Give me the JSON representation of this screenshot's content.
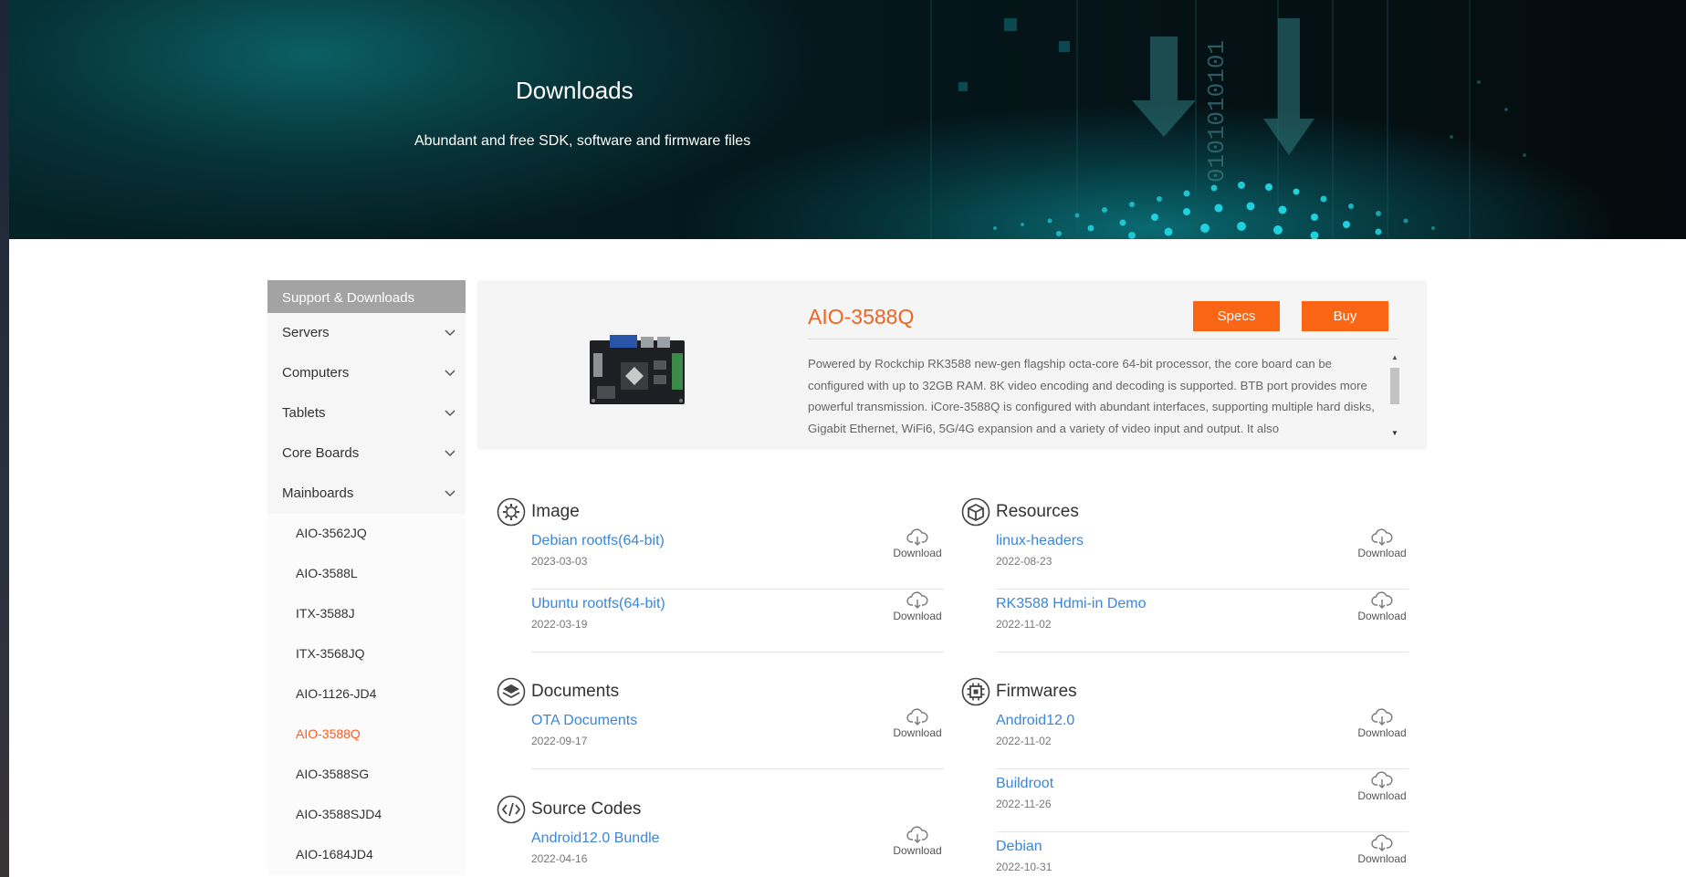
{
  "banner": {
    "title": "Downloads",
    "subtitle": "Abundant and free SDK, software and firmware files"
  },
  "sidebar": {
    "header": "Support & Downloads",
    "categories": [
      {
        "label": "Servers"
      },
      {
        "label": "Computers"
      },
      {
        "label": "Tablets"
      },
      {
        "label": "Core Boards"
      },
      {
        "label": "Mainboards"
      }
    ],
    "mainboards": [
      {
        "label": "AIO-3562JQ"
      },
      {
        "label": "AIO-3588L"
      },
      {
        "label": "ITX-3588J"
      },
      {
        "label": "ITX-3568JQ"
      },
      {
        "label": "AIO-1126-JD4"
      },
      {
        "label": "AIO-3588Q"
      },
      {
        "label": "AIO-3588SG"
      },
      {
        "label": "AIO-3588SJD4"
      },
      {
        "label": "AIO-1684JD4"
      }
    ],
    "active_item": "AIO-3588Q"
  },
  "product": {
    "title": "AIO-3588Q",
    "specs_label": "Specs",
    "buy_label": "Buy",
    "description": "Powered by Rockchip RK3588 new-gen flagship octa-core 64-bit processor, the core board can be configured with up to 32GB RAM. 8K video encoding and decoding is supported. BTB port provides more powerful transmission. iCore-3588Q is configured with abundant interfaces, supporting multiple hard disks, Gigabit Ethernet, WiFi6, 5G/4G expansion and a variety of video input and output. It also"
  },
  "download_label": "Download",
  "sections": {
    "image": {
      "title": "Image",
      "icon": "gear-icon",
      "items": [
        {
          "name": "Debian rootfs(64-bit)",
          "date": "2023-03-03"
        },
        {
          "name": "Ubuntu rootfs(64-bit)",
          "date": "2022-03-19"
        }
      ]
    },
    "documents": {
      "title": "Documents",
      "icon": "layers-icon",
      "items": [
        {
          "name": "OTA Documents",
          "date": "2022-09-17"
        }
      ]
    },
    "source_codes": {
      "title": "Source Codes",
      "icon": "code-icon",
      "items": [
        {
          "name": "Android12.0 Bundle",
          "date": "2022-04-16"
        }
      ]
    },
    "resources": {
      "title": "Resources",
      "icon": "box-icon",
      "items": [
        {
          "name": "linux-headers",
          "date": "2022-08-23"
        },
        {
          "name": "RK3588 Hdmi-in Demo",
          "date": "2022-11-02"
        }
      ]
    },
    "firmwares": {
      "title": "Firmwares",
      "icon": "chip-icon",
      "items": [
        {
          "name": "Android12.0",
          "date": "2022-11-02"
        },
        {
          "name": "Buildroot",
          "date": "2022-11-26"
        },
        {
          "name": "Debian",
          "date": "2022-10-31"
        }
      ]
    }
  },
  "colors": {
    "accent": "#fb6516",
    "link": "#3b86d9",
    "sidebar_header": "#a3a3a3"
  }
}
